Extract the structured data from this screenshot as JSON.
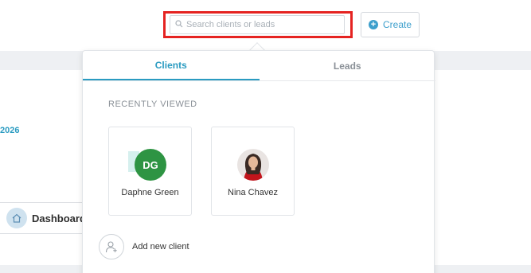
{
  "background": {
    "date_fragment": "2026",
    "dashboard_label": "Dashboard"
  },
  "search": {
    "placeholder": "Search clients or leads",
    "value": ""
  },
  "create_button": {
    "label": "Create"
  },
  "popover": {
    "tabs": [
      {
        "label": "Clients",
        "active": true
      },
      {
        "label": "Leads",
        "active": false
      }
    ],
    "section_heading": "RECENTLY VIEWED",
    "recent": [
      {
        "name": "Daphne Green",
        "initials": "DG",
        "avatar_type": "initials",
        "avatar_color": "#2e9443"
      },
      {
        "name": "Nina Chavez",
        "avatar_type": "photo"
      }
    ],
    "add_new_label": "Add new client"
  },
  "colors": {
    "accent": "#2a9bc1",
    "highlight_border": "#e52321"
  },
  "icons": {
    "search": "search-icon",
    "create": "plus-circle-icon",
    "dashboard": "home-icon",
    "add_client": "add-user-icon"
  }
}
